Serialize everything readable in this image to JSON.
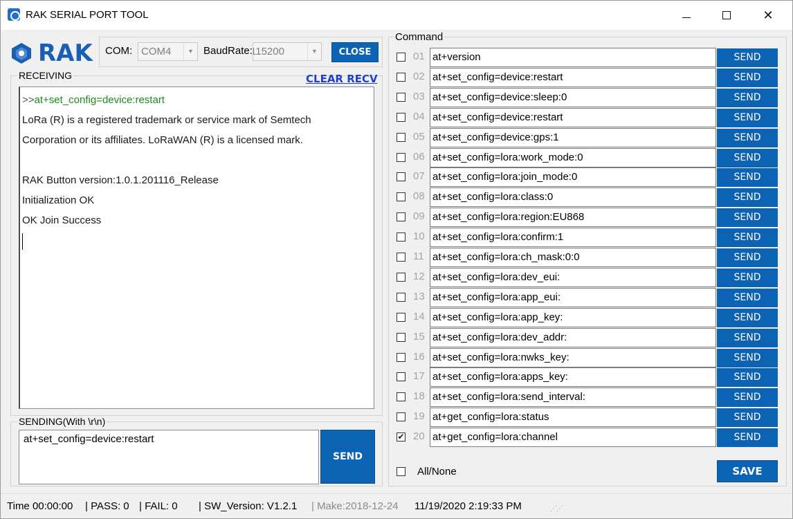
{
  "window": {
    "title": "RAK SERIAL PORT TOOL",
    "app_icon": "serial-port-app-icon",
    "controls": [
      "minimize",
      "maximize",
      "close"
    ]
  },
  "logo": {
    "text": "RAK",
    "icon": "rak-logo-mark"
  },
  "connection": {
    "com_label": "COM:",
    "com_value": "COM4",
    "baud_label": "BaudRate:",
    "baud_value": "115200",
    "close_label": "CLOSE"
  },
  "receiving": {
    "label": "RECEIVING",
    "clear_label": "CLEAR RECV",
    "lines": [
      {
        "prefix": ">>",
        "text": "at+set_config=device:restart",
        "type": "command"
      },
      {
        "text": "LoRa (R) is a registered trademark or service mark of Semtech",
        "type": "output"
      },
      {
        "text": "Corporation or its affiliates. LoRaWAN (R) is a licensed mark.",
        "type": "output"
      },
      {
        "text": "",
        "type": "output"
      },
      {
        "text": "RAK Button version:1.0.1.201116_Release",
        "type": "output"
      },
      {
        "text": "Initialization OK",
        "type": "output"
      },
      {
        "text": "OK Join Success",
        "type": "output"
      }
    ]
  },
  "sending": {
    "label": "SENDING(With \\r\\n)",
    "value": "at+set_config=device:restart",
    "send_label": "SEND"
  },
  "command": {
    "label": "Command",
    "send_label": "SEND",
    "rows": [
      {
        "num": "01",
        "text": "at+version",
        "checked": false
      },
      {
        "num": "02",
        "text": "at+set_config=device:restart",
        "checked": false
      },
      {
        "num": "03",
        "text": "at+set_config=device:sleep:0",
        "checked": false
      },
      {
        "num": "04",
        "text": "at+set_config=device:restart",
        "checked": false
      },
      {
        "num": "05",
        "text": "at+set_config=device:gps:1",
        "checked": false
      },
      {
        "num": "06",
        "text": "at+set_config=lora:work_mode:0",
        "checked": false
      },
      {
        "num": "07",
        "text": "at+set_config=lora:join_mode:0",
        "checked": false
      },
      {
        "num": "08",
        "text": "at+set_config=lora:class:0",
        "checked": false
      },
      {
        "num": "09",
        "text": "at+set_config=lora:region:EU868",
        "checked": false
      },
      {
        "num": "10",
        "text": "at+set_config=lora:confirm:1",
        "checked": false
      },
      {
        "num": "11",
        "text": "at+set_config=lora:ch_mask:0:0",
        "checked": false
      },
      {
        "num": "12",
        "text": "at+set_config=lora:dev_eui:",
        "checked": false
      },
      {
        "num": "13",
        "text": "at+set_config=lora:app_eui:",
        "checked": false
      },
      {
        "num": "14",
        "text": "at+set_config=lora:app_key:",
        "checked": false
      },
      {
        "num": "15",
        "text": "at+set_config=lora:dev_addr:",
        "checked": false
      },
      {
        "num": "16",
        "text": "at+set_config=lora:nwks_key:",
        "checked": false
      },
      {
        "num": "17",
        "text": "at+set_config=lora:apps_key:",
        "checked": false
      },
      {
        "num": "18",
        "text": "at+set_config=lora:send_interval:",
        "checked": false
      },
      {
        "num": "19",
        "text": "at+get_config=lora:status",
        "checked": false
      },
      {
        "num": "20",
        "text": "at+get_config=lora:channel",
        "checked": true
      }
    ],
    "all_none_label": "All/None",
    "save_label": "SAVE"
  },
  "status": {
    "time": "Time  00:00:00",
    "pass": "| PASS:  0",
    "fail": "| FAIL:  0",
    "sw_version": "| SW_Version:  V1.2.1",
    "make": "| Make:2018-12-24",
    "datetime": "11/19/2020 2:19:33 PM"
  },
  "colors": {
    "accent": "#0c62b3",
    "link": "#1f3fd0",
    "command_text": "#1c8a1c",
    "row_number": "#a3a3a3"
  }
}
